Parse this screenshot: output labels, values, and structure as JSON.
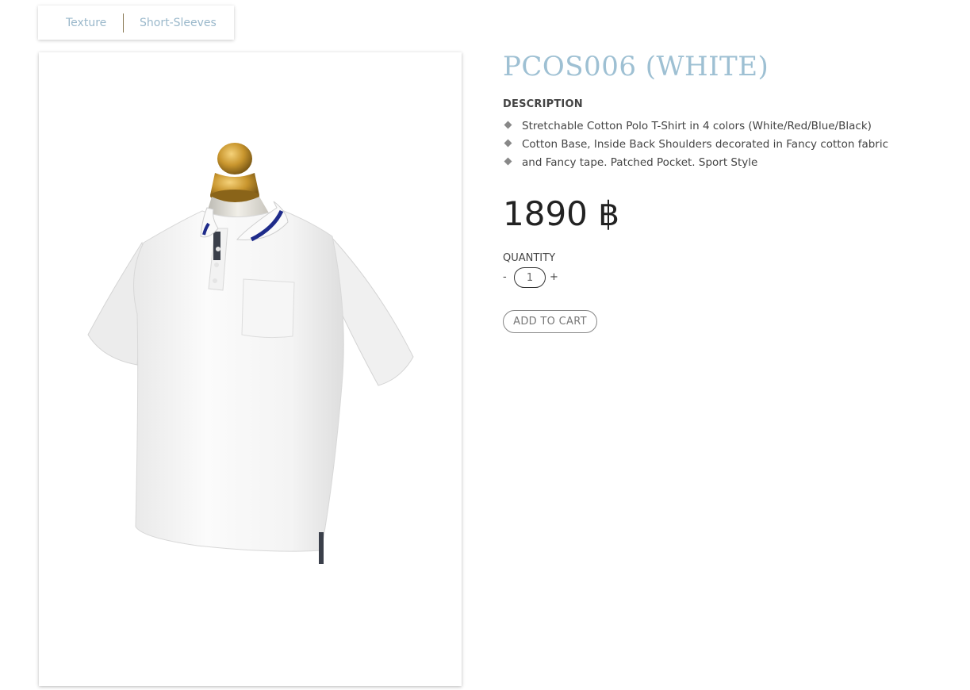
{
  "breadcrumbs": {
    "texture": "Texture",
    "short_sleeves": "Short-Sleeves"
  },
  "product": {
    "title": "PCOS006 (WHITE)",
    "description_heading": "DESCRIPTION",
    "description_items": [
      "Stretchable Cotton Polo T-Shirt in 4 colors (White/Red/Blue/Black)",
      "Cotton Base, Inside Back Shoulders decorated in Fancy cotton fabric",
      "and Fancy tape. Patched Pocket. Sport Style"
    ],
    "price": "1890 ฿",
    "image_alt": "White polo shirt on mannequin"
  },
  "quantity": {
    "label": "QUANTITY",
    "minus": "-",
    "plus": "+",
    "value": "1"
  },
  "cart": {
    "add_label": "ADD TO CART"
  },
  "colors": {
    "title": "#9ec0d3",
    "breadcrumb_link": "#9ab8cb",
    "collar_stripe": "#1e2b8a",
    "mannequin_head": "#c9962e"
  }
}
